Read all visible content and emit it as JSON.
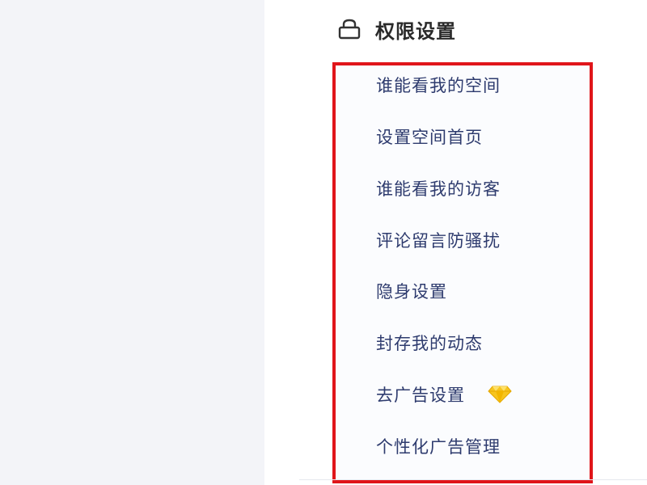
{
  "section": {
    "title": "权限设置",
    "icon": "lock-icon"
  },
  "menu": {
    "items": [
      {
        "label": "谁能看我的空间"
      },
      {
        "label": "设置空间首页"
      },
      {
        "label": "谁能看我的访客"
      },
      {
        "label": "评论留言防骚扰"
      },
      {
        "label": "隐身设置"
      },
      {
        "label": "封存我的动态"
      },
      {
        "label": "去广告设置",
        "badge_icon": "diamond-icon"
      },
      {
        "label": "个性化广告管理"
      }
    ]
  },
  "colors": {
    "highlight_border": "#e0151a",
    "menu_text": "#2e3b6e",
    "title_text": "#2a2a2a",
    "left_background": "#f3f4f8",
    "diamond": "#f7c51e"
  }
}
